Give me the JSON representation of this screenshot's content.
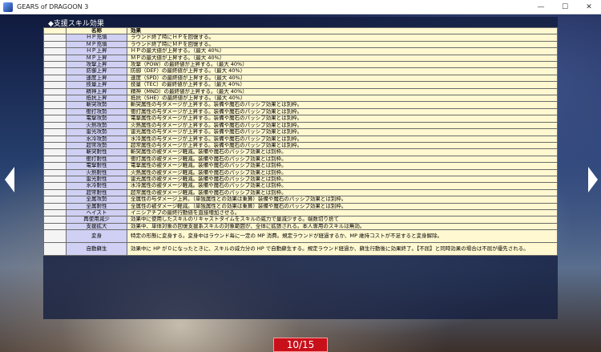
{
  "window": {
    "title": "GEARS of DRAGOON 3",
    "controls": [
      "—",
      "☐",
      "✕"
    ]
  },
  "section_title": "◆支援スキル効果",
  "table": {
    "headers": {
      "blank": "",
      "name": "名称",
      "effect": "効果"
    },
    "rows": [
      {
        "name": "ＨＰ充填",
        "effect": "ラウンド終了時にＨＰを回復する。"
      },
      {
        "name": "ＭＰ充填",
        "effect": "ラウンド終了時にＭＰを回復する。"
      },
      {
        "name": "ＨＰ上昇",
        "effect": "ＨＰの最大値が上昇する。（最大 40%）"
      },
      {
        "name": "ＭＰ上昇",
        "effect": "ＭＰの最大値が上昇する。（最大 40%）"
      },
      {
        "name": "攻撃上昇",
        "effect": "攻撃（POW）の最終値が上昇する。（最大 40%）"
      },
      {
        "name": "防御上昇",
        "effect": "防御（DEF）の最終値が上昇する。（最大 40%）"
      },
      {
        "name": "速度上昇",
        "effect": "速度（SPD）の最終値が上昇する。（最大 40%）"
      },
      {
        "name": "技量上昇",
        "effect": "技量（TEC）の最終値が上昇する。（最大 40%）"
      },
      {
        "name": "精神上昇",
        "effect": "精神（MND）の最終値が上昇する。（最大 40%）"
      },
      {
        "name": "抵抗上昇",
        "effect": "抵抗（SHE）の最終値が上昇する。（最大 40%）"
      },
      {
        "name": "斬突攻勢",
        "effect": "斬突属性の与ダメージが上昇する。装備や魔石のパッシブ効果とは別枠。"
      },
      {
        "name": "衝打攻勢",
        "effect": "衝打属性の与ダメージが上昇する。装備や魔石のパッシブ効果とは別枠。"
      },
      {
        "name": "電撃攻勢",
        "effect": "電撃属性の与ダメージが上昇する。装備や魔石のパッシブ効果とは別枠。"
      },
      {
        "name": "火熱攻勢",
        "effect": "火熱属性の与ダメージが上昇する。装備や魔石のパッシブ効果とは別枠。"
      },
      {
        "name": "雷光攻勢",
        "effect": "雷光属性の与ダメージが上昇する。装備や魔石のパッシブ効果とは別枠。"
      },
      {
        "name": "水冷攻勢",
        "effect": "水冷属性の与ダメージが上昇する。装備や魔石のパッシブ効果とは別枠。"
      },
      {
        "name": "超常攻勢",
        "effect": "超常属性の与ダメージが上昇する。装備や魔石のパッシブ効果とは別枠。"
      },
      {
        "name": "斬突耐性",
        "effect": "斬突属性の被ダメージ軽減。装備や魔石のパッシブ効果とは別枠。"
      },
      {
        "name": "衝打耐性",
        "effect": "衝打属性の被ダメージ軽減。装備や魔石のパッシブ効果とは別枠。"
      },
      {
        "name": "電撃耐性",
        "effect": "電撃属性の被ダメージ軽減。装備や魔石のパッシブ効果とは別枠。"
      },
      {
        "name": "火熱耐性",
        "effect": "火熱属性の被ダメージ軽減。装備や魔石のパッシブ効果とは別枠。"
      },
      {
        "name": "雷光耐性",
        "effect": "雷光属性の被ダメージ軽減。装備や魔石のパッシブ効果とは別枠。"
      },
      {
        "name": "水冷耐性",
        "effect": "水冷属性の被ダメージ軽減。装備や魔石のパッシブ効果とは別枠。"
      },
      {
        "name": "超常耐性",
        "effect": "超常属性の被ダメージ軽減。装備や魔石のパッシブ効果とは別枠。"
      },
      {
        "name": "全属攻勢",
        "effect": "全属性の与ダメージ上昇。（単独属性との効果は乗算）装備や魔石のパッシブ効果とは別枠。"
      },
      {
        "name": "全属耐性",
        "effect": "全属性の被ダメージ軽減。（単独属性との効果は乗算）装備や魔石のパッシブ効果とは別枠。"
      },
      {
        "name": "ヘイスト",
        "effect": "イニシアチブの最終行動値を直接増加させる。"
      },
      {
        "name": "再使用減少",
        "effect": "効果中に使用したスキルのリキャストタイムをスキルの威力で量減少する。端数切り捨て"
      },
      {
        "name": "支援拡大",
        "effect": "効果中、単体対象の回復支援系スキルの対象範囲が、全体に拡張される。本人専用のスキルは無効。"
      },
      {
        "name": "変身",
        "effect": "特定の形態に変身する。変身中はラウンド毎に一定の MP 消費。規定ラウンドが経過するか、MP 維持コストが不足すると変身解除。"
      },
      {
        "name": "自動蘇生",
        "effect": "効果中に HP が０になったときに、スキルの威力分の HP で自動蘇生する。規定ラウンド経過か、蘇生行動後に効果終了。【不屈】と同時効果の場合は不屈が優先される。"
      }
    ]
  },
  "page_indicator": "10/15",
  "nav": {
    "prev": "previous-page",
    "next": "next-page"
  }
}
